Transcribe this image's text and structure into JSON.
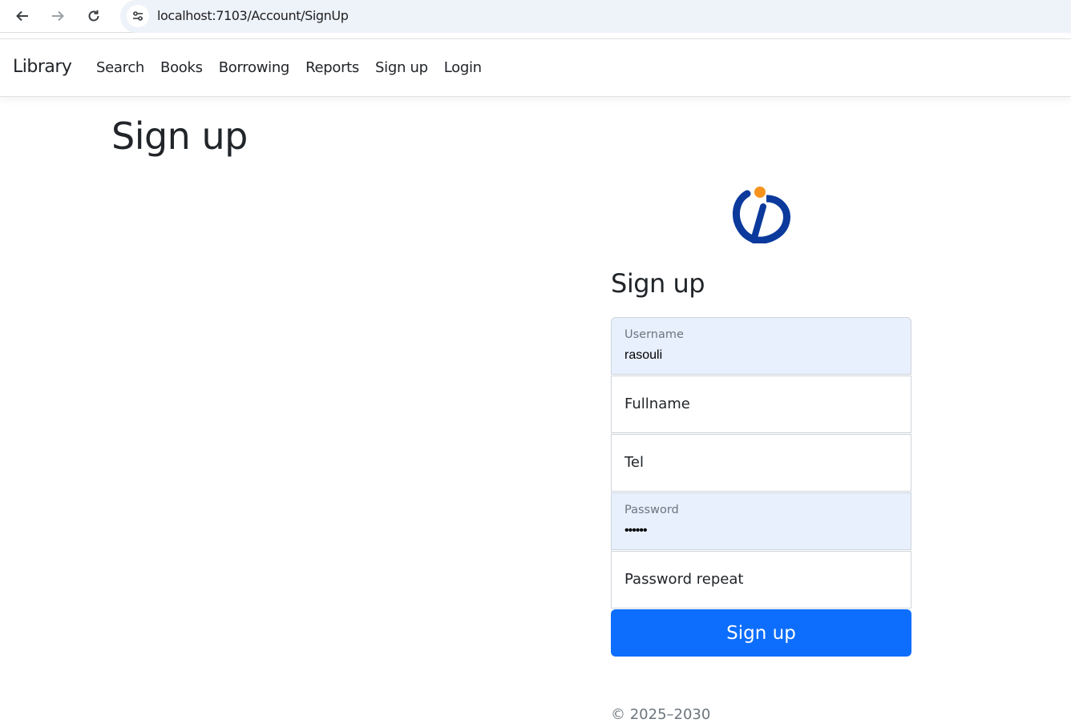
{
  "browser": {
    "url": "localhost:7103/Account/SignUp",
    "back_icon": "arrow-left-icon",
    "forward_icon": "arrow-right-icon",
    "reload_icon": "reload-icon",
    "site_info_icon": "tune-icon"
  },
  "navbar": {
    "brand": "Library",
    "links": [
      "Search",
      "Books",
      "Borrowing",
      "Reports",
      "Sign up",
      "Login"
    ]
  },
  "page": {
    "title": "Sign up"
  },
  "form": {
    "title": "Sign up",
    "logo_icon": "library-logo-icon",
    "fields": [
      {
        "label": "Username",
        "value": "rasouli",
        "filled": true
      },
      {
        "label": "Fullname",
        "value": "",
        "filled": false
      },
      {
        "label": "Tel",
        "value": "",
        "filled": false
      },
      {
        "label": "Password",
        "value": "••••••",
        "filled": true
      },
      {
        "label": "Password repeat",
        "value": "",
        "filled": false
      }
    ],
    "submit_label": "Sign up"
  },
  "footer": {
    "text": "© 2025–2030"
  },
  "colors": {
    "primary": "#0d6efd",
    "autofill": "#e8f0fe",
    "logo_blue": "#0b3a9c",
    "logo_orange": "#f7941d"
  }
}
